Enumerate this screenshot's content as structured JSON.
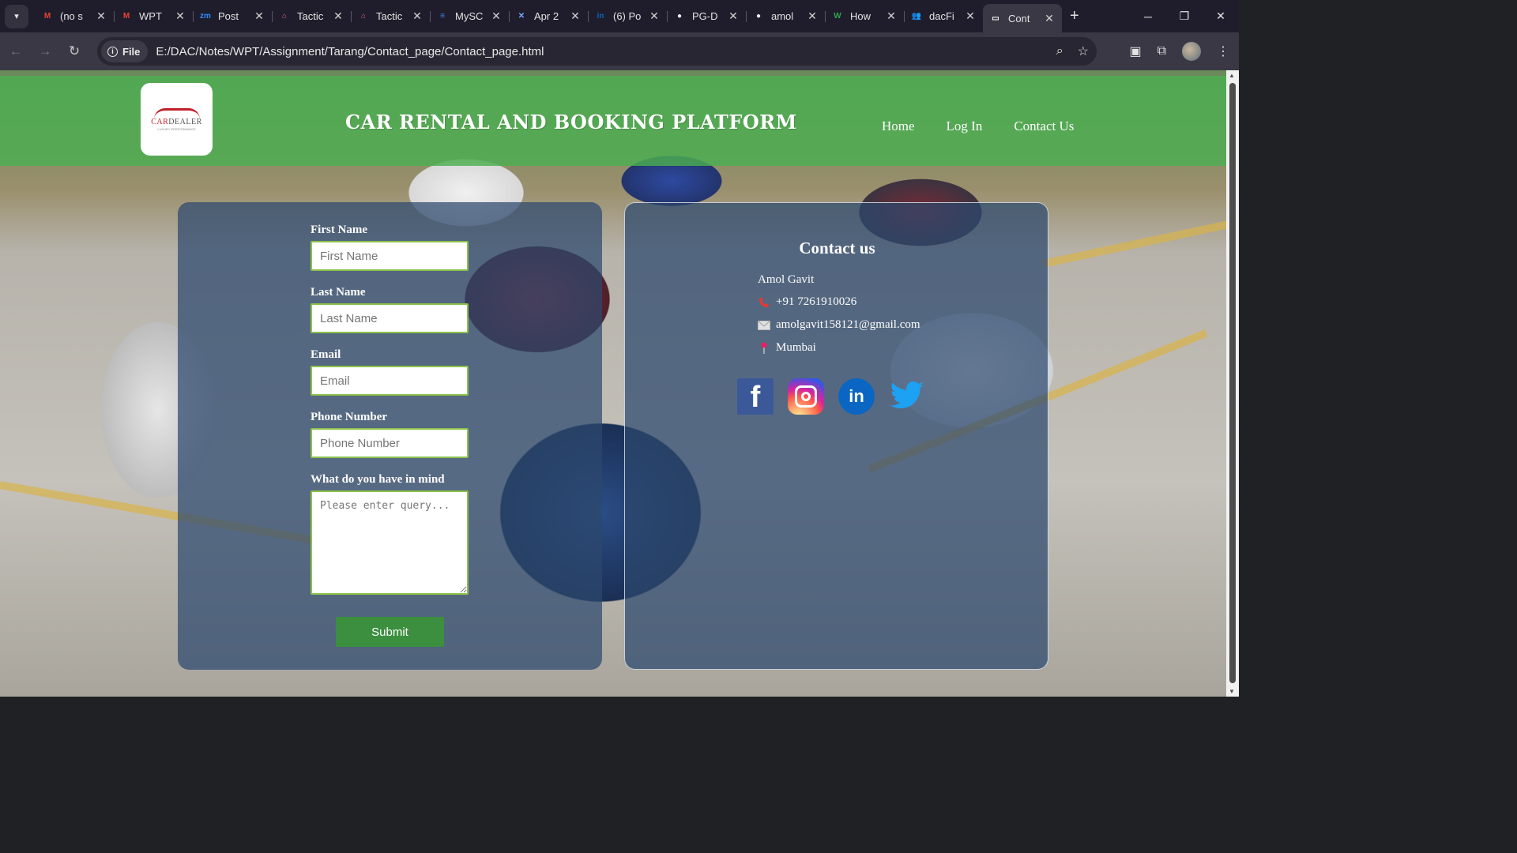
{
  "browser": {
    "tabs": [
      {
        "title": "(no s",
        "icon": "gmail-icon",
        "color": "#ea4335",
        "glyph": "M"
      },
      {
        "title": "WPT",
        "icon": "gmail-icon",
        "color": "#ea4335",
        "glyph": "M"
      },
      {
        "title": "Post",
        "icon": "zoom-icon",
        "color": "#2d8cff",
        "glyph": "zm"
      },
      {
        "title": "Tactic",
        "icon": "tactiq-icon",
        "color": "#e85a9a",
        "glyph": "⌂"
      },
      {
        "title": "Tactic",
        "icon": "tactiq-icon",
        "color": "#e85a9a",
        "glyph": "⌂"
      },
      {
        "title": "MySC",
        "icon": "docs-icon",
        "color": "#4285f4",
        "glyph": "≡"
      },
      {
        "title": "Apr 2",
        "icon": "spark-icon",
        "color": "#7aa7ff",
        "glyph": "✕"
      },
      {
        "title": "(6) Po",
        "icon": "linkedin-icon",
        "color": "#0a66c2",
        "glyph": "in"
      },
      {
        "title": "PG-D",
        "icon": "github-icon",
        "color": "#f0f0f0",
        "glyph": "●"
      },
      {
        "title": "amol",
        "icon": "github-icon",
        "color": "#f0f0f0",
        "glyph": "●"
      },
      {
        "title": "How",
        "icon": "w-icon",
        "color": "#2ea44f",
        "glyph": "W"
      },
      {
        "title": "dacFi",
        "icon": "people-icon",
        "color": "#6a8cff",
        "glyph": "👥"
      },
      {
        "title": "Cont",
        "icon": "page-icon",
        "color": "#ffffff",
        "glyph": "▭"
      }
    ],
    "active_tab_index": 12,
    "file_chip": "File",
    "url": "E:/DAC/Notes/WPT/Assignment/Tarang/Contact_page/Contact_page.html"
  },
  "header": {
    "logo_text_red": "CAR",
    "logo_text_rest": "DEALER",
    "logo_sub": "LUXURY PERFORMANCE",
    "title": "CAR RENTAL AND BOOKING PLATFORM",
    "nav": [
      "Home",
      "Log In",
      "Contact Us"
    ]
  },
  "form": {
    "fields": [
      {
        "label": "First Name",
        "placeholder": "First Name"
      },
      {
        "label": "Last Name",
        "placeholder": "Last Name"
      },
      {
        "label": "Email",
        "placeholder": "Email"
      },
      {
        "label": "Phone Number",
        "placeholder": "Phone Number"
      }
    ],
    "query_label": "What do you have in mind",
    "query_placeholder": "Please enter query...",
    "submit": "Submit"
  },
  "contact": {
    "title": "Contact us",
    "name": "Amol Gavit",
    "phone": "+91 7261910026",
    "email": "amolgavit158121@gmail.com",
    "location": "Mumbai",
    "socials": [
      "facebook-icon",
      "instagram-icon",
      "linkedin-icon",
      "twitter-icon"
    ]
  },
  "colors": {
    "header_green": "#4caf50",
    "panel_blue": "#2c486e",
    "input_border": "#8bc34a",
    "submit_green": "#3b8f3e"
  }
}
